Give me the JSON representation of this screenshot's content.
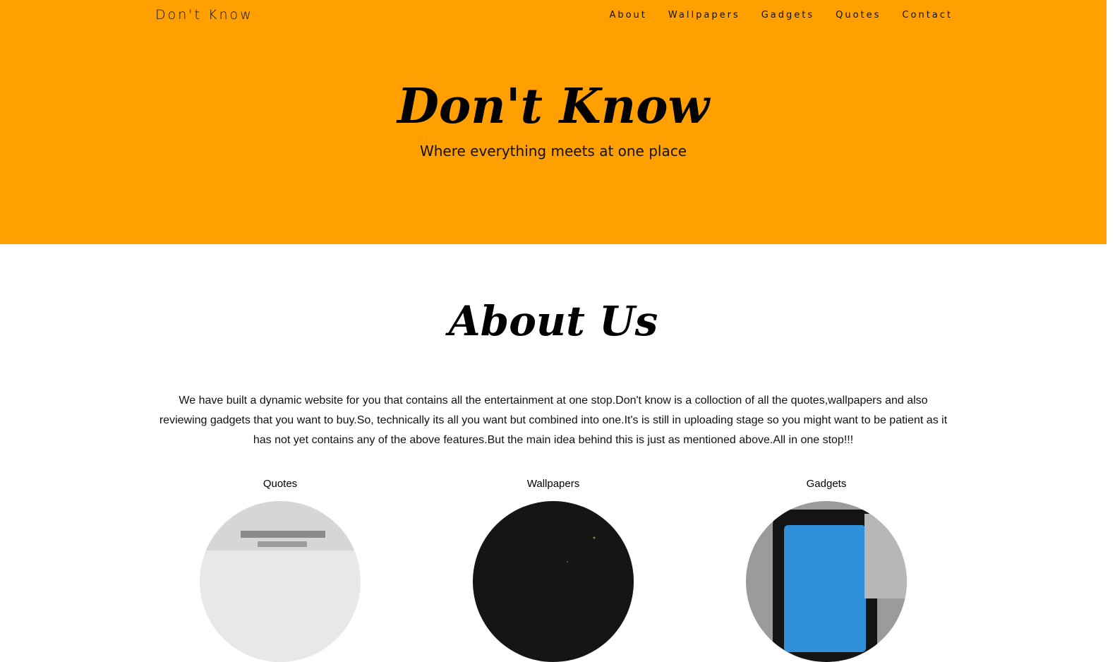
{
  "header": {
    "brand": "Don't Know",
    "nav": [
      {
        "label": "About"
      },
      {
        "label": "Wallpapers"
      },
      {
        "label": "Gadgets"
      },
      {
        "label": "Quotes"
      },
      {
        "label": "Contact"
      }
    ]
  },
  "hero": {
    "title": "Don't Know",
    "subtitle": "Where everything meets at one place"
  },
  "about": {
    "title": "About Us",
    "text": "We have built a dynamic website for you that contains all the entertainment at one stop.Don't know is a colloction of all the quotes,wallpapers and also reviewing gadgets that you want to buy.So, technically its all you want but combined into one.It's is still in uploading stage so you might want to be patient as it has not yet contains any of the above features.But the main idea behind this is just as mentioned above.All in one stop!!!"
  },
  "sections": [
    {
      "label": "Quotes"
    },
    {
      "label": "Wallpapers"
    },
    {
      "label": "Gadgets"
    }
  ],
  "colors": {
    "accent": "#ff9f00",
    "background": "#ffffff",
    "text": "#000000"
  }
}
